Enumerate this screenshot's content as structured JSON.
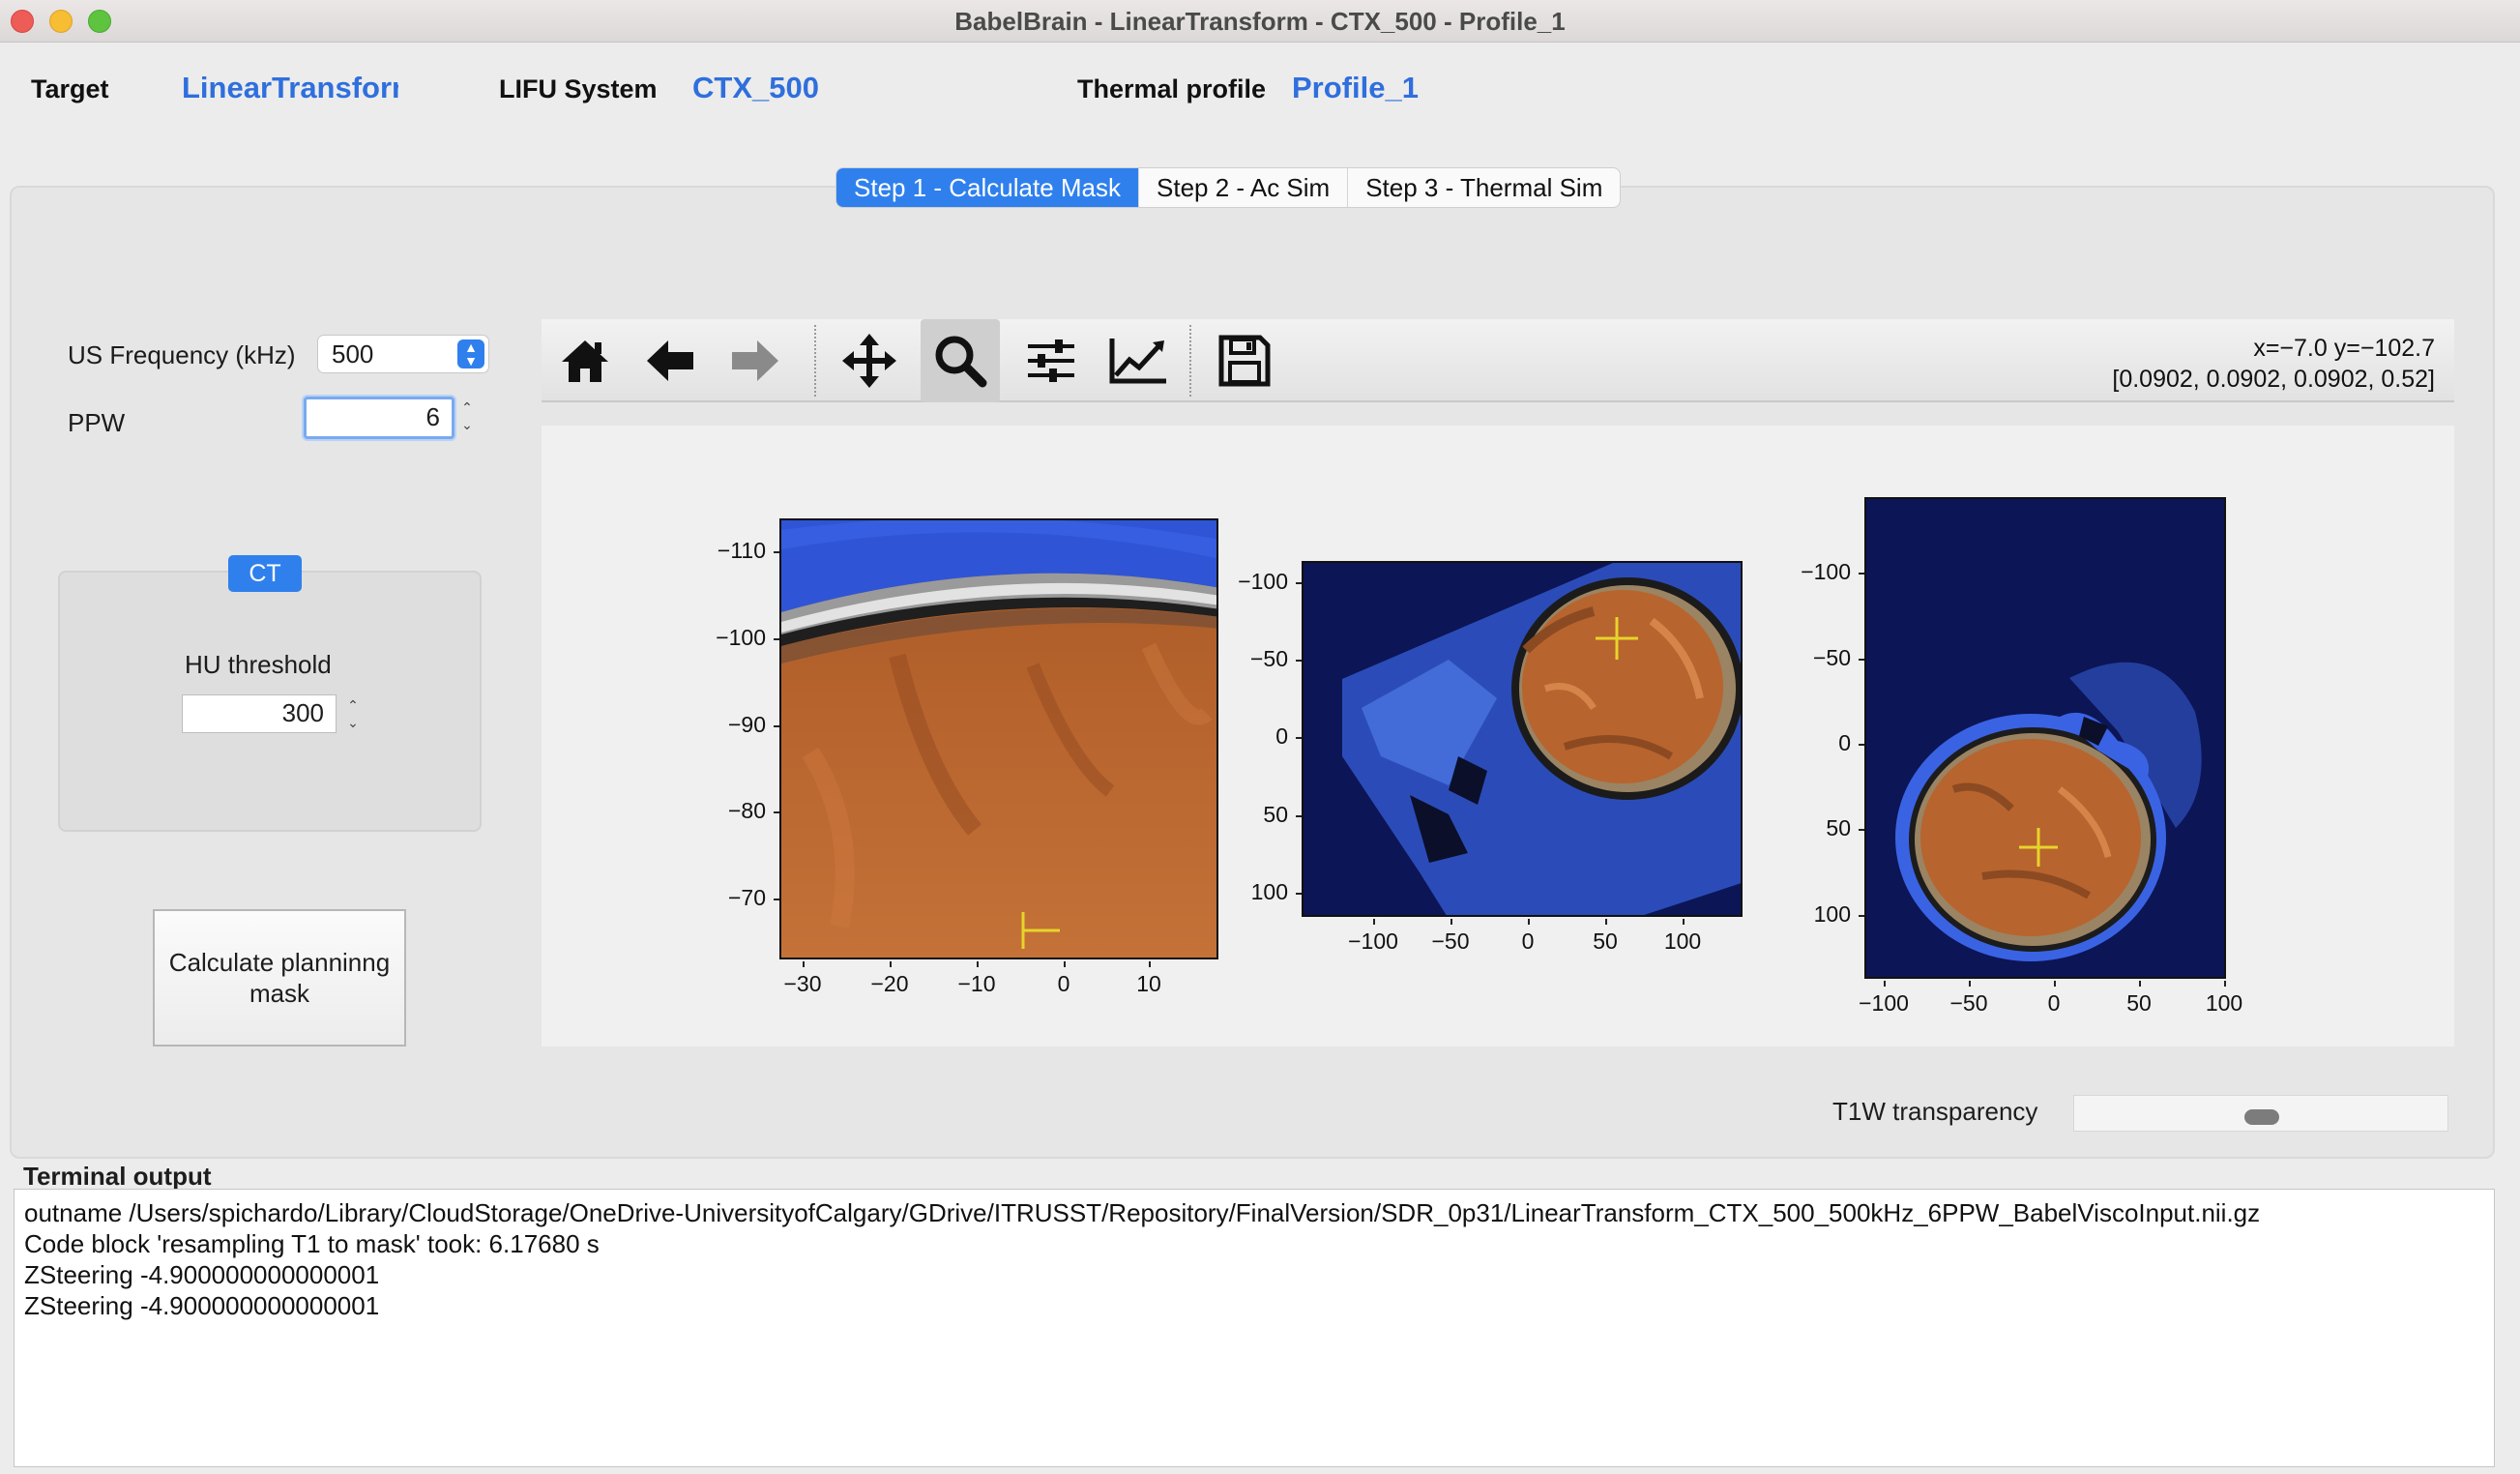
{
  "window": {
    "title": "BabelBrain - LinearTransform - CTX_500 - Profile_1"
  },
  "header": {
    "target_label": "Target",
    "target_value": "LinearTransform",
    "lifu_label": "LIFU System",
    "lifu_value": "CTX_500",
    "thermal_label": "Thermal profile",
    "thermal_value": "Profile_1"
  },
  "tabs": [
    {
      "label": "Step 1 - Calculate Mask",
      "active": true
    },
    {
      "label": "Step 2 - Ac Sim",
      "active": false
    },
    {
      "label": "Step 3 - Thermal Sim",
      "active": false
    }
  ],
  "left_panel": {
    "freq_label": "US Frequency (kHz)",
    "freq_value": "500",
    "ppw_label": "PPW",
    "ppw_value": "6",
    "ct_badge": "CT",
    "hu_label": "HU threshold",
    "hu_value": "300",
    "calc_button": "Calculate planninng mask"
  },
  "toolbar": {
    "tools": [
      "home-icon",
      "back-icon",
      "forward-icon",
      "pan-icon",
      "zoom-icon",
      "subplots-icon",
      "edit-axes-icon",
      "save-icon"
    ],
    "active_tool": "zoom-icon",
    "coord_line1": "x=−7.0 y=−102.7",
    "coord_line2": "[0.0902, 0.0902, 0.0902, 0.52]"
  },
  "plots": [
    {
      "yticks": [
        "−110",
        "−100",
        "−90",
        "−80",
        "−70"
      ],
      "xticks": [
        "−30",
        "−20",
        "−10",
        "0",
        "10"
      ]
    },
    {
      "yticks": [
        "−100",
        "−50",
        "0",
        "50",
        "100"
      ],
      "xticks": [
        "−100",
        "−50",
        "0",
        "50",
        "100"
      ]
    },
    {
      "yticks": [
        "−100",
        "−50",
        "0",
        "50",
        "100"
      ],
      "xticks": [
        "−100",
        "−50",
        "0",
        "50",
        "100"
      ]
    }
  ],
  "slider": {
    "label": "T1W transparency",
    "value_fraction": 0.5
  },
  "terminal": {
    "title": "Terminal output",
    "lines": [
      "outname /Users/spichardo/Library/CloudStorage/OneDrive-UniversityofCalgary/GDrive/ITRUSST/Repository/FinalVersion/SDR_0p31/LinearTransform_CTX_500_500kHz_6PPW_BabelViscoInput.nii.gz",
      "Code block 'resampling T1 to mask' took: 6.17680 s",
      "ZSteering -4.900000000000001",
      "ZSteering -4.900000000000001"
    ]
  },
  "colors": {
    "accent": "#2f80ed",
    "brain": "#b8642e",
    "mask_blue": "#3f63d8",
    "background_navy": "#0c1556",
    "marker": "#e7d42a"
  }
}
